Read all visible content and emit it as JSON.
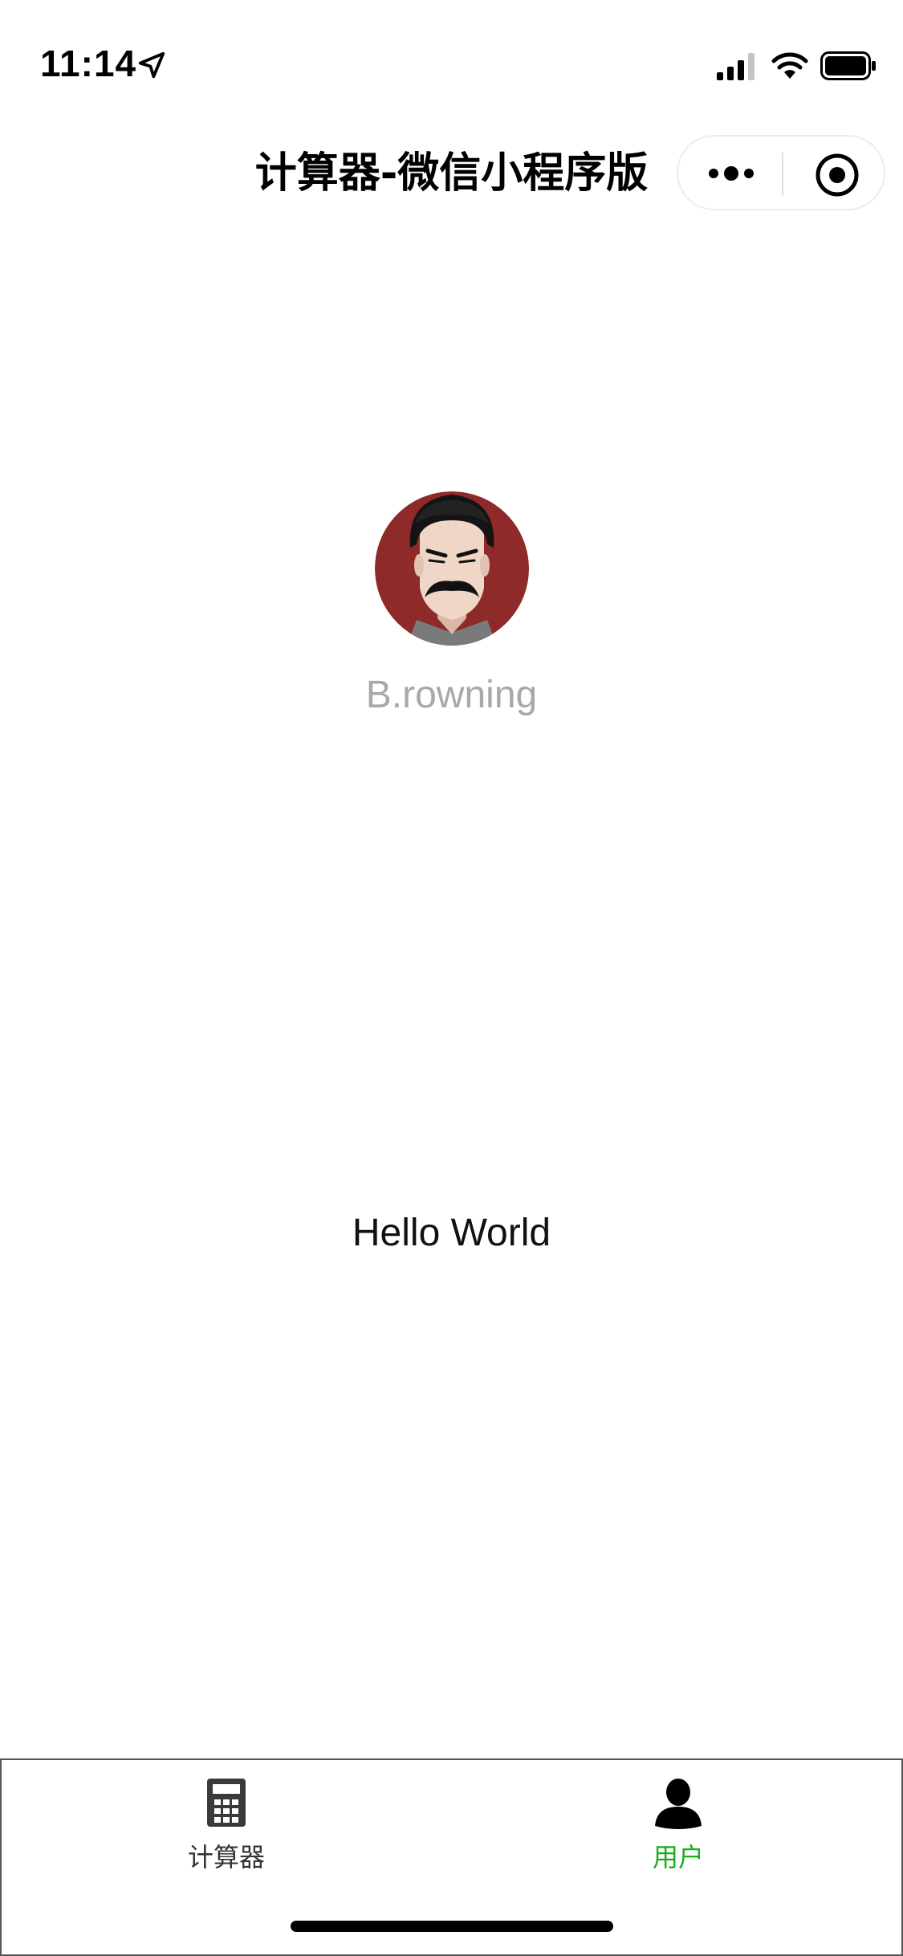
{
  "status_bar": {
    "time": "11:14",
    "icons": [
      "location-arrow-icon",
      "cellular-signal-icon",
      "wifi-icon",
      "battery-icon"
    ]
  },
  "nav": {
    "title": "计算器-微信小程序版",
    "capsule_icons": [
      "more-icon",
      "close-target-icon"
    ]
  },
  "profile": {
    "avatar_icon": "avatar-illustration",
    "nickname": "B.rowning"
  },
  "main": {
    "motto": "Hello World"
  },
  "tab_bar": {
    "items": [
      {
        "label": "计算器",
        "icon": "calculator-icon",
        "active": false
      },
      {
        "label": "用户",
        "icon": "user-icon",
        "active": true
      }
    ],
    "active_color": "#1aad19",
    "inactive_color": "#333333"
  }
}
